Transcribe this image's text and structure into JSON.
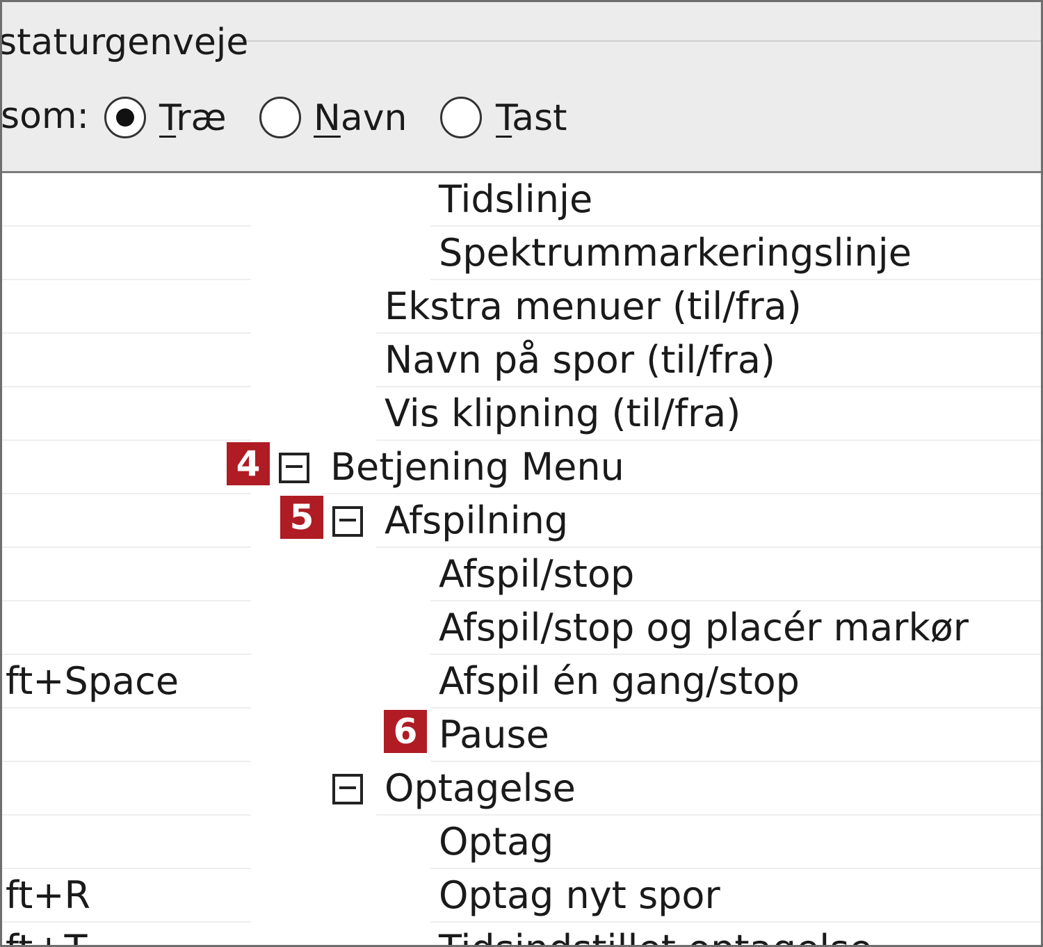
{
  "toolbar": {
    "group_title": "staturgenveje",
    "view_label": "som:",
    "options": [
      {
        "label": "Træ",
        "mnemonic": "T",
        "rest": "ræ",
        "checked": true
      },
      {
        "label": "Navn",
        "mnemonic": "N",
        "rest": "avn",
        "checked": false
      },
      {
        "label": "Tast",
        "mnemonic": "T",
        "rest": "ast",
        "checked": false
      }
    ]
  },
  "tree": {
    "rows": [
      {
        "label": "Tidslinje",
        "shortcut": "",
        "expander": false,
        "badge": ""
      },
      {
        "label": "Spektrummarkeringslinje",
        "shortcut": "",
        "expander": false,
        "badge": ""
      },
      {
        "label": "Ekstra menuer (til/fra)",
        "shortcut": "",
        "expander": false,
        "badge": ""
      },
      {
        "label": "Navn på spor (til/fra)",
        "shortcut": "",
        "expander": false,
        "badge": ""
      },
      {
        "label": "Vis klipning (til/fra)",
        "shortcut": "",
        "expander": false,
        "badge": ""
      },
      {
        "label": "Betjening Menu",
        "shortcut": "",
        "expander": true,
        "badge": "4"
      },
      {
        "label": "Afspilning",
        "shortcut": "",
        "expander": true,
        "badge": "5"
      },
      {
        "label": "Afspil/stop",
        "shortcut": "",
        "expander": false,
        "badge": ""
      },
      {
        "label": "Afspil/stop og placér markør",
        "shortcut": "",
        "expander": false,
        "badge": ""
      },
      {
        "label": "Afspil én gang/stop",
        "shortcut": "ift+Space",
        "expander": false,
        "badge": ""
      },
      {
        "label": "Pause",
        "shortcut": "",
        "expander": false,
        "badge": "6"
      },
      {
        "label": "Optagelse",
        "shortcut": "",
        "expander": true,
        "badge": ""
      },
      {
        "label": "Optag",
        "shortcut": "",
        "expander": false,
        "badge": ""
      },
      {
        "label": "Optag nyt spor",
        "shortcut": "ift+R",
        "expander": false,
        "badge": ""
      },
      {
        "label": "Tidsindstillet optagelse",
        "shortcut": "ift+T",
        "expander": false,
        "badge": ""
      }
    ]
  }
}
